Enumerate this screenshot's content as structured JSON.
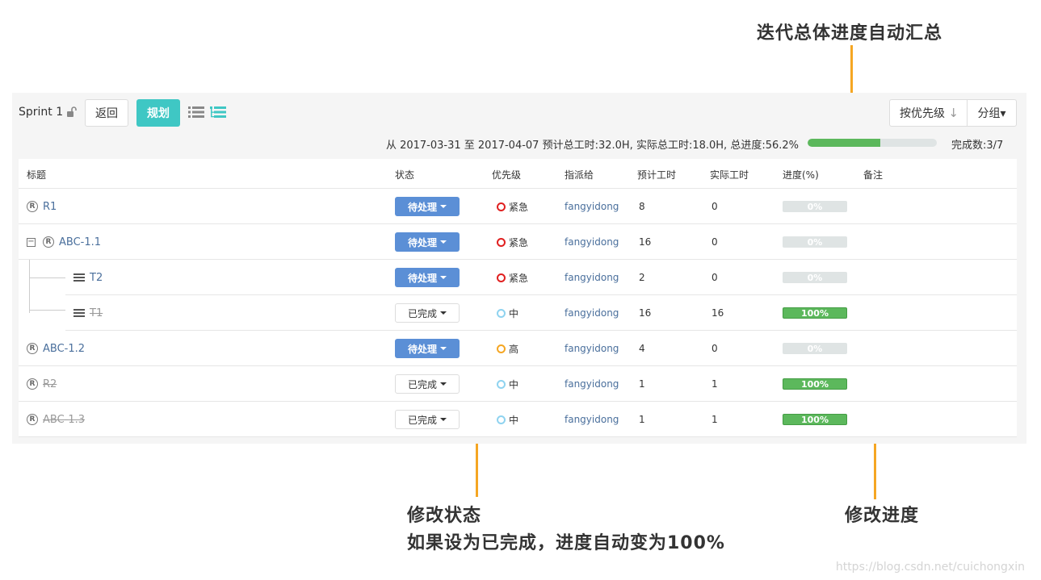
{
  "annotations": {
    "top": "迭代总体进度自动汇总",
    "status_title": "修改状态",
    "status_desc": "如果设为已完成，进度自动变为100%",
    "progress": "修改进度"
  },
  "toolbar": {
    "sprint_name": "Sprint 1",
    "back_label": "返回",
    "plan_label": "规划",
    "sort_label": "按优先级",
    "sort_arrow": "↓",
    "group_label": "分组▾"
  },
  "summary": {
    "text": "从 2017-03-31 至 2017-04-07   预计总工时:32.0H,   实际总工时:18.0H,  总进度:56.2%",
    "progress_pct": 56.2,
    "done_count": "完成数:3/7"
  },
  "table": {
    "headers": [
      "标题",
      "状态",
      "优先级",
      "指派给",
      "预计工时",
      "实际工时",
      "进度(%)",
      "备注"
    ],
    "rows": [
      {
        "title": "R1",
        "type": "R",
        "status": "待处理",
        "priority": "紧急",
        "assignee": "fangyidong",
        "est": "8",
        "act": "0",
        "progress": "0%"
      },
      {
        "title": "ABC-1.1",
        "type": "R",
        "status": "待处理",
        "priority": "紧急",
        "assignee": "fangyidong",
        "est": "16",
        "act": "0",
        "progress": "0%"
      },
      {
        "title": "T2",
        "type": "T",
        "status": "待处理",
        "priority": "紧急",
        "assignee": "fangyidong",
        "est": "2",
        "act": "0",
        "progress": "0%"
      },
      {
        "title": "T1",
        "type": "T",
        "status": "已完成",
        "priority": "中",
        "assignee": "fangyidong",
        "est": "16",
        "act": "16",
        "progress": "100%"
      },
      {
        "title": "ABC-1.2",
        "type": "R",
        "status": "待处理",
        "priority": "高",
        "assignee": "fangyidong",
        "est": "4",
        "act": "0",
        "progress": "0%"
      },
      {
        "title": "R2",
        "type": "R",
        "status": "已完成",
        "priority": "中",
        "assignee": "fangyidong",
        "est": "1",
        "act": "1",
        "progress": "100%"
      },
      {
        "title": "ABC-1.3",
        "type": "R",
        "status": "已完成",
        "priority": "中",
        "assignee": "fangyidong",
        "est": "1",
        "act": "1",
        "progress": "100%"
      }
    ]
  },
  "colors": {
    "accent": "#3fc7c4",
    "pending": "#5b8fd6",
    "progress": "#5cb85c",
    "urgent": "#e02020",
    "high": "#f5a623",
    "medium": "#8fd3f0",
    "callout": "#f5a623"
  },
  "icons": {
    "lock": "unlock-icon",
    "list_view": "list-view-icon",
    "tree_view": "tree-view-icon"
  },
  "watermark": "https://blog.csdn.net/cuichongxin"
}
